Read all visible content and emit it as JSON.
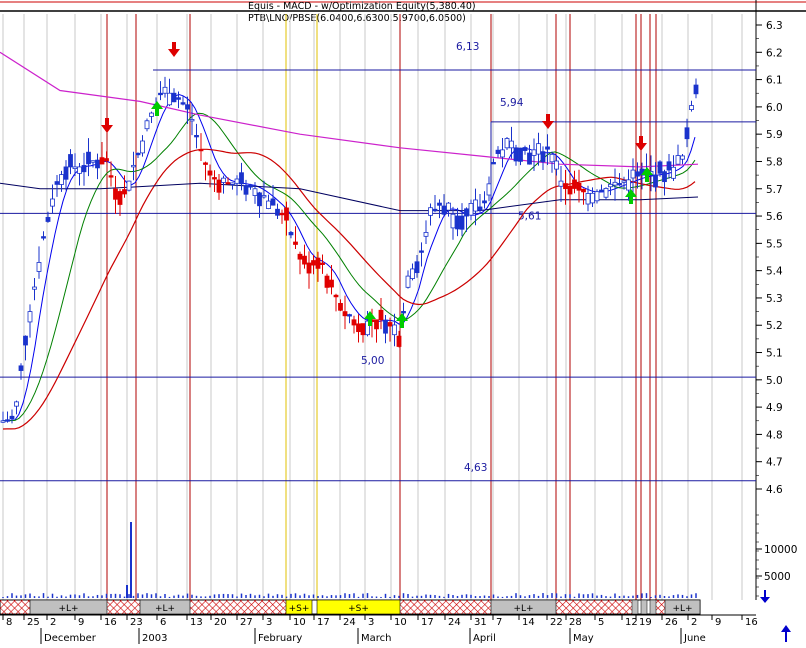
{
  "header": {
    "title_line1": "Equis - MACD - w/Optimization Equity(5,380.40)",
    "title_line2": "PTB\\LNO/PBSE(6.0400,6.6300,5.9700,6.0500)"
  },
  "colors": {
    "candle_up": "#1a33cc",
    "candle_down": "#e00000",
    "price_line": "#0000cc",
    "ma_fast": "#0000ee",
    "ma_green": "#008000",
    "ma_red": "#cc0000",
    "ma_navy": "#000060",
    "ma_magenta": "#cc22cc",
    "signal_line": "#b00000",
    "buy_arrow": "#00cc00",
    "sell_arrow": "#dd0000",
    "grid": "#c8c8c8",
    "volume": "#1a33cc",
    "band_yellow": "#ffff00",
    "band_hatch": "#cc0000",
    "band_long": "#c0c0c0"
  },
  "chart_data": {
    "type": "candlestick",
    "ylim": [
      4.55,
      6.35
    ],
    "y_ticks": [
      "6.3",
      "6.2",
      "6.1",
      "6.0",
      "5.9",
      "5.8",
      "5.7",
      "5.6",
      "5.5",
      "5.4",
      "5.3",
      "5.2",
      "5.1",
      "5.0",
      "4.9",
      "4.8",
      "4.7",
      "4.6"
    ],
    "volume_ticks": [
      "10000",
      "5000"
    ],
    "x_tick_labels": [
      "8",
      "25",
      "2",
      "9",
      "16",
      "23",
      "6",
      "13",
      "20",
      "27",
      "3",
      "10",
      "17",
      "24",
      "3",
      "10",
      "17",
      "24",
      "31",
      "7",
      "14",
      "22",
      "28",
      "5",
      "12",
      "19",
      "26",
      "2",
      "9",
      "16"
    ],
    "month_labels": [
      "December",
      "2003",
      "February",
      "March",
      "April",
      "May",
      "June"
    ],
    "horizontal_levels": [
      {
        "label": "6,13",
        "value": 6.135
      },
      {
        "label": "5,94",
        "value": 5.945
      },
      {
        "label": "5,61",
        "value": 5.61
      },
      {
        "label": "5,00",
        "value": 5.01
      },
      {
        "label": "4,63",
        "value": 4.63
      }
    ],
    "signal_bars_count": 13,
    "bands": [
      "+L+",
      "+L+",
      "+S+",
      "+S+",
      "+L+",
      "+L+"
    ]
  }
}
